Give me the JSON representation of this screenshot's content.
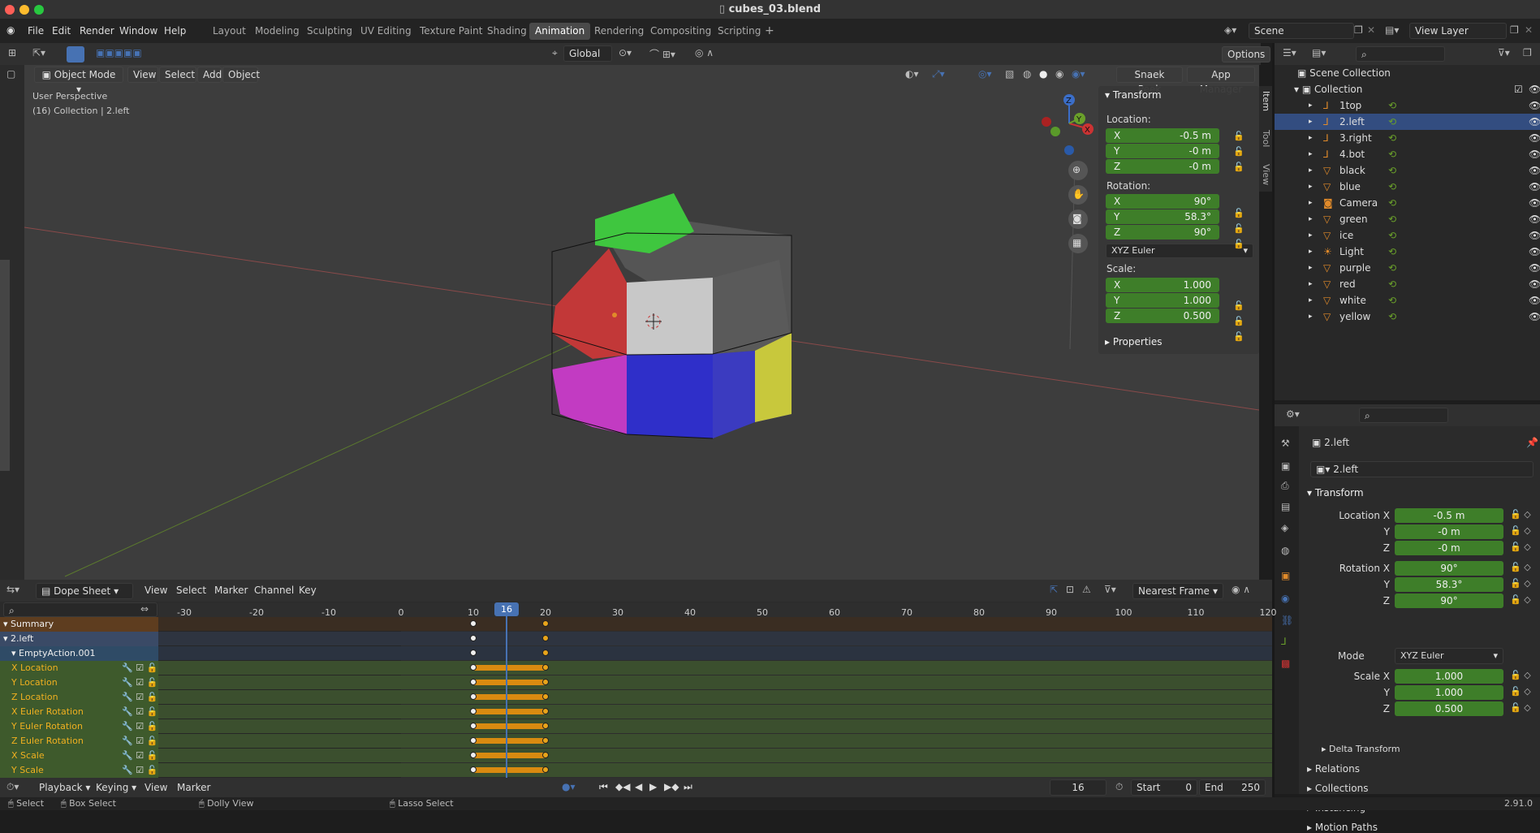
{
  "window": {
    "title": "cubes_03.blend"
  },
  "menu": [
    "File",
    "Edit",
    "Render",
    "Window",
    "Help"
  ],
  "workspaces": [
    "Layout",
    "Modeling",
    "Sculpting",
    "UV Editing",
    "Texture Paint",
    "Shading",
    "Animation",
    "Rendering",
    "Compositing",
    "Scripting"
  ],
  "active_workspace": "Animation",
  "scene": {
    "label": "Scene",
    "view_layer": "View Layer"
  },
  "viewport": {
    "transform_orientation": "Global",
    "options": "Options",
    "mode": "Object Mode",
    "menus": [
      "View",
      "Select",
      "Add",
      "Object"
    ],
    "buttons": [
      "Snaek Peek",
      "App Manager"
    ],
    "overlay_line1": "User Perspective",
    "overlay_line2": "(16) Collection | 2.left",
    "sidebar_tabs": [
      "Item",
      "Tool",
      "View"
    ]
  },
  "npanel": {
    "title": "Transform",
    "location_label": "Location:",
    "location": [
      {
        "axis": "X",
        "value": "-0.5 m"
      },
      {
        "axis": "Y",
        "value": "-0 m"
      },
      {
        "axis": "Z",
        "value": "-0 m"
      }
    ],
    "rotation_label": "Rotation:",
    "rotation": [
      {
        "axis": "X",
        "value": "90°"
      },
      {
        "axis": "Y",
        "value": "58.3°"
      },
      {
        "axis": "Z",
        "value": "90°"
      }
    ],
    "rotation_mode": "XYZ Euler",
    "scale_label": "Scale:",
    "scale": [
      {
        "axis": "X",
        "value": "1.000"
      },
      {
        "axis": "Y",
        "value": "1.000"
      },
      {
        "axis": "Z",
        "value": "0.500"
      }
    ],
    "properties": "Properties"
  },
  "outliner": {
    "root": "Scene Collection",
    "collection": "Collection",
    "items": [
      {
        "name": "1top",
        "type": "empty",
        "selected": false
      },
      {
        "name": "2.left",
        "type": "empty",
        "selected": true
      },
      {
        "name": "3.right",
        "type": "empty",
        "selected": false
      },
      {
        "name": "4.bot",
        "type": "empty",
        "selected": false
      },
      {
        "name": "black",
        "type": "mesh",
        "selected": false
      },
      {
        "name": "blue",
        "type": "mesh",
        "selected": false
      },
      {
        "name": "Camera",
        "type": "camera",
        "selected": false
      },
      {
        "name": "green",
        "type": "mesh",
        "selected": false
      },
      {
        "name": "ice",
        "type": "mesh",
        "selected": false
      },
      {
        "name": "Light",
        "type": "light",
        "selected": false
      },
      {
        "name": "purple",
        "type": "mesh",
        "selected": false
      },
      {
        "name": "red",
        "type": "mesh",
        "selected": false
      },
      {
        "name": "white",
        "type": "mesh",
        "selected": false
      },
      {
        "name": "yellow",
        "type": "mesh",
        "selected": false
      }
    ]
  },
  "properties": {
    "object_name": "2.left",
    "object_field": "2.left",
    "transform": "Transform",
    "location": [
      {
        "label": "Location X",
        "value": "-0.5 m"
      },
      {
        "label": "Y",
        "value": "-0 m"
      },
      {
        "label": "Z",
        "value": "-0 m"
      }
    ],
    "rotation": [
      {
        "label": "Rotation X",
        "value": "90°"
      },
      {
        "label": "Y",
        "value": "58.3°"
      },
      {
        "label": "Z",
        "value": "90°"
      }
    ],
    "mode_label": "Mode",
    "mode_value": "XYZ Euler",
    "scale": [
      {
        "label": "Scale X",
        "value": "1.000"
      },
      {
        "label": "Y",
        "value": "1.000"
      },
      {
        "label": "Z",
        "value": "0.500"
      }
    ],
    "sections": [
      "Delta Transform",
      "Relations",
      "Collections",
      "Instancing",
      "Motion Paths"
    ]
  },
  "dopesheet": {
    "mode": "Dope Sheet",
    "menus": [
      "View",
      "Select",
      "Marker",
      "Channel",
      "Key"
    ],
    "snap": "Nearest Frame",
    "current_frame": "16",
    "ticks": [
      "-30",
      "-20",
      "-10",
      "0",
      "10",
      "20",
      "30",
      "40",
      "50",
      "60",
      "70",
      "80",
      "90",
      "100",
      "110",
      "120"
    ],
    "channels": [
      {
        "name": "Summary",
        "kind": "summary"
      },
      {
        "name": "2.left",
        "kind": "object"
      },
      {
        "name": "EmptyAction.001",
        "kind": "action"
      },
      {
        "name": "X Location",
        "kind": "fcurve"
      },
      {
        "name": "Y Location",
        "kind": "fcurve"
      },
      {
        "name": "Z Location",
        "kind": "fcurve"
      },
      {
        "name": "X Euler Rotation",
        "kind": "fcurve"
      },
      {
        "name": "Y Euler Rotation",
        "kind": "fcurve"
      },
      {
        "name": "Z Euler Rotation",
        "kind": "fcurve"
      },
      {
        "name": "X Scale",
        "kind": "fcurve"
      },
      {
        "name": "Y Scale",
        "kind": "fcurve"
      }
    ],
    "keyframes": [
      10,
      20
    ]
  },
  "timeline": {
    "menus": [
      "Playback",
      "Keying",
      "View",
      "Marker"
    ],
    "frame": "16",
    "start_label": "Start",
    "start": "0",
    "end_label": "End",
    "end": "250"
  },
  "statusbar": {
    "items": [
      "Select",
      "Box Select",
      "Dolly View",
      "Lasso Select"
    ],
    "version": "2.91.0"
  },
  "colors": {
    "accent": "#4772b3",
    "green_field": "#3e7e29",
    "keyframe": "#e8a41a",
    "selection": "#334d80"
  }
}
